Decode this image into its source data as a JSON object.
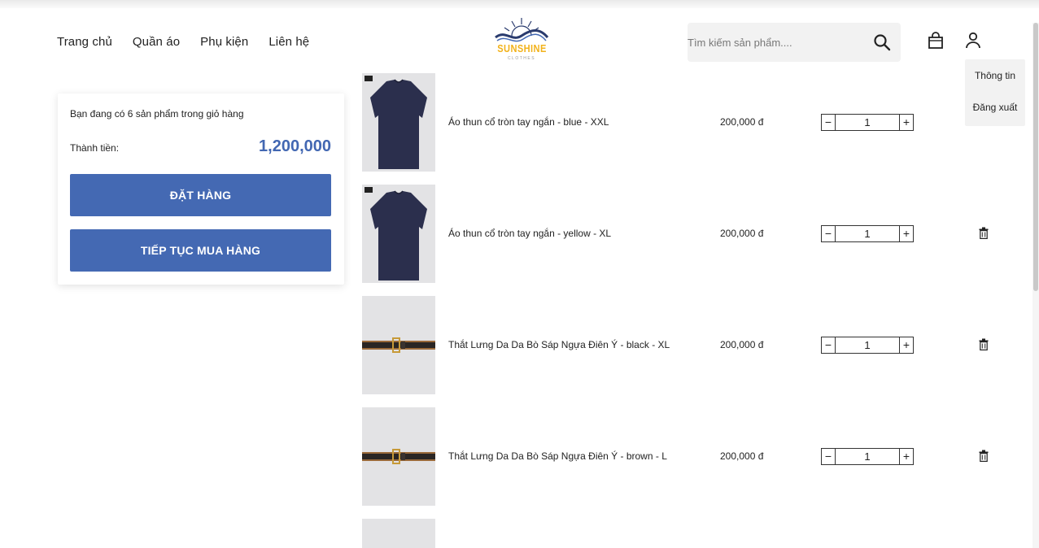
{
  "nav": {
    "items": [
      "Trang chủ",
      "Quần áo",
      "Phụ kiện",
      "Liên hệ"
    ]
  },
  "logo": {
    "text": "SUNSHINE",
    "subtext": "CLOTHES"
  },
  "search": {
    "placeholder": "Tìm kiếm sản phẩm....",
    "value": ""
  },
  "user_menu": {
    "items": [
      "Thông tin",
      "Đăng xuất"
    ]
  },
  "summary": {
    "count_text": "Bạn đang có 6 sản phẩm trong giỏ hàng",
    "total_label": "Thành tiền:",
    "total_value": "1,200,000",
    "order_button": "ĐẶT HÀNG",
    "continue_button": "TIẾP TỤC MUA HÀNG"
  },
  "cart": {
    "items": [
      {
        "name": "Áo thun cổ tròn tay ngắn - blue - XXL",
        "price": "200,000 đ",
        "qty": "1",
        "image": "tshirt"
      },
      {
        "name": "Áo thun cổ tròn tay ngắn - yellow - XL",
        "price": "200,000 đ",
        "qty": "1",
        "image": "tshirt"
      },
      {
        "name": "Thắt Lưng Da Da Bò Sáp Ngựa Điên Ý - black - XL",
        "price": "200,000 đ",
        "qty": "1",
        "image": "belt"
      },
      {
        "name": "Thắt Lưng Da Da Bò Sáp Ngựa Điên Ý - brown - L",
        "price": "200,000 đ",
        "qty": "1",
        "image": "belt"
      }
    ],
    "minus_label": "−",
    "plus_label": "+"
  },
  "colors": {
    "accent": "#4469b3",
    "logo": "#f2b21b"
  },
  "icons": {
    "search": "search-icon",
    "bag": "shopping-bag-icon",
    "user": "user-icon",
    "trash": "trash-icon"
  }
}
